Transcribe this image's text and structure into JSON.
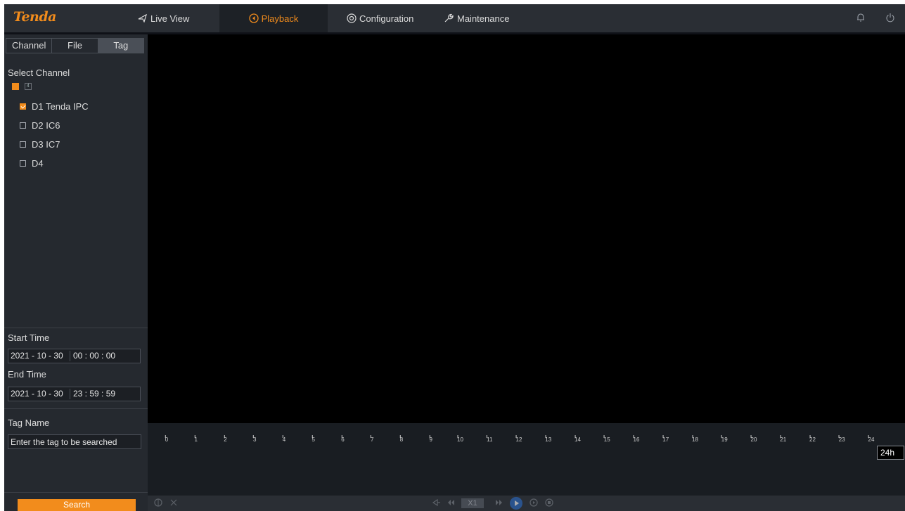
{
  "header": {
    "logo": "Tenda",
    "nav": [
      {
        "label": "Live View",
        "icon": "live-view-icon"
      },
      {
        "label": "Playback",
        "icon": "playback-icon",
        "active": true
      },
      {
        "label": "Configuration",
        "icon": "configuration-icon"
      },
      {
        "label": "Maintenance",
        "icon": "wrench-icon"
      }
    ],
    "right_icons": [
      "bell-icon",
      "power-icon"
    ]
  },
  "sidebar": {
    "tabs": [
      {
        "label": "Channel"
      },
      {
        "label": "File"
      },
      {
        "label": "Tag",
        "active": true
      }
    ],
    "select_channel_label": "Select Channel",
    "channel_toggle_count": "4",
    "channels": [
      {
        "label": "D1 Tenda IPC",
        "checked": true
      },
      {
        "label": "D2 IC6",
        "checked": false
      },
      {
        "label": "D3 IC7",
        "checked": false
      },
      {
        "label": "D4",
        "checked": false
      }
    ],
    "start_time": {
      "label": "Start Time",
      "date": "2021 - 10 - 30",
      "time": "00 : 00 : 00"
    },
    "end_time": {
      "label": "End Time",
      "date": "2021 - 10 - 30",
      "time": "23 : 59 : 59"
    },
    "tag_name": {
      "label": "Tag Name",
      "placeholder": "Enter the tag to be searched",
      "value": ""
    },
    "search_label": "Search"
  },
  "timeline": {
    "hours": [
      "0",
      "1",
      "2",
      "3",
      "4",
      "5",
      "6",
      "7",
      "8",
      "9",
      "10",
      "11",
      "12",
      "13",
      "14",
      "15",
      "16",
      "17",
      "18",
      "19",
      "20",
      "21",
      "22",
      "23",
      "24"
    ],
    "zoom_label": "24h"
  },
  "controls": {
    "speed_label": "X1",
    "icons": [
      "snapshot-icon",
      "clip-icon",
      "slow-icon",
      "step-back-icon",
      "fast-icon",
      "play-icon",
      "step-forward-icon",
      "stop-icon"
    ]
  },
  "colors": {
    "accent": "#f28c1c",
    "topbar": "#2a2e34",
    "sidebar": "#25292f",
    "video": "#000000",
    "timeline": "#191d22"
  }
}
